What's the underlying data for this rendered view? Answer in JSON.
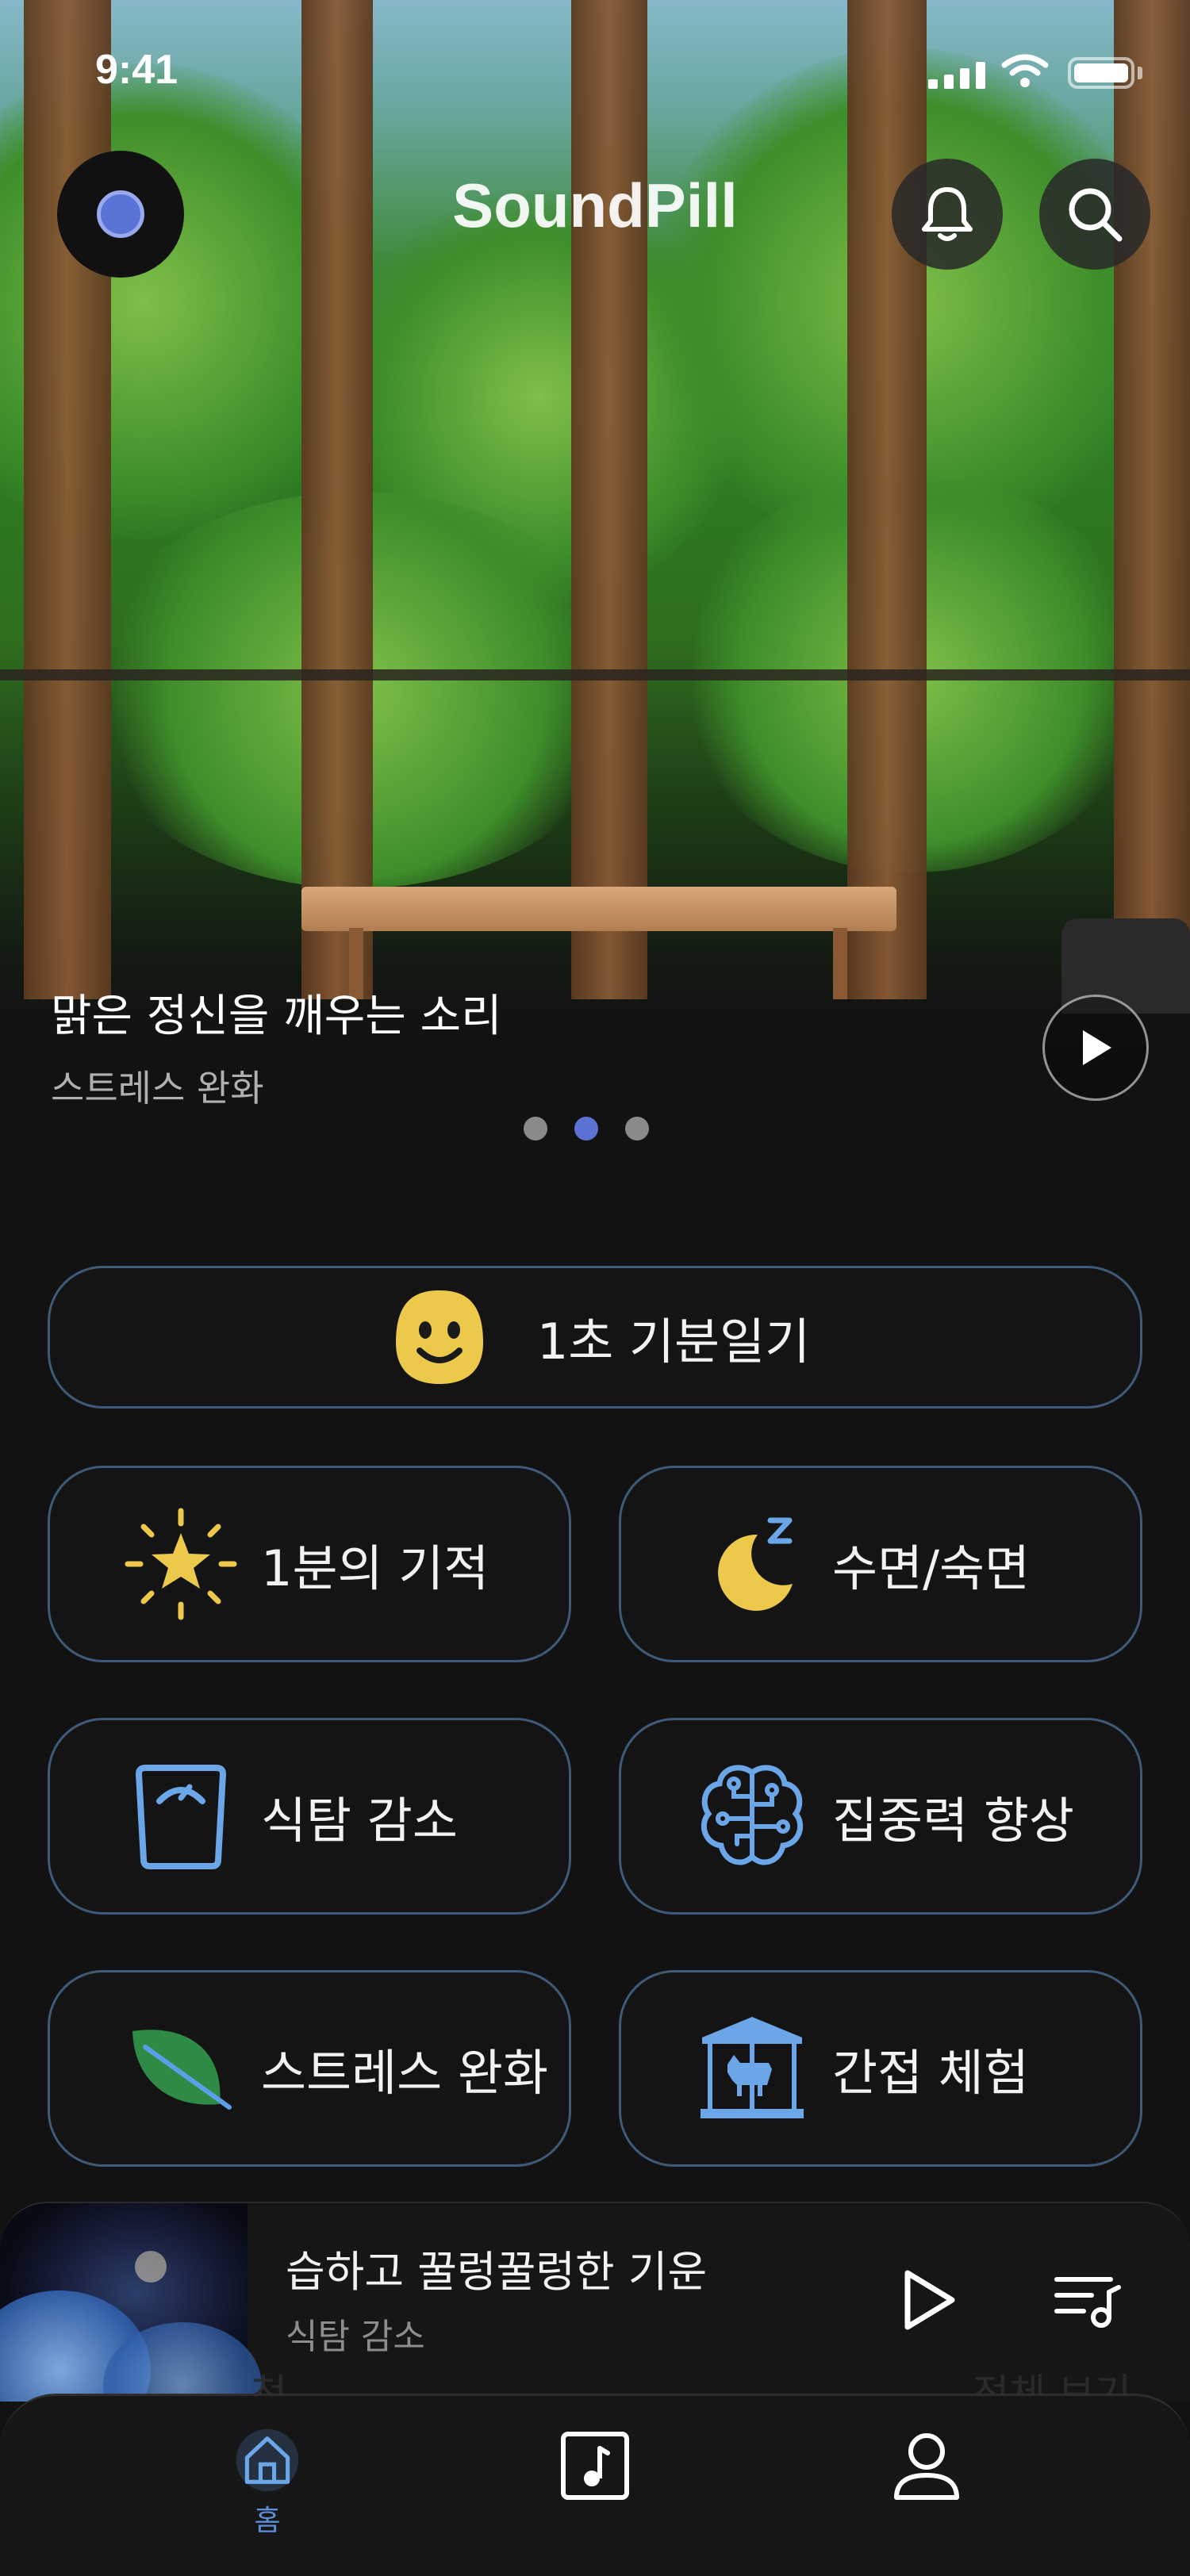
{
  "status_bar": {
    "time": "9:41"
  },
  "header": {
    "app_title": "SoundPill"
  },
  "hero": {
    "title": "맑은 정신을 깨우는 소리",
    "subtitle": "스트레스 완화",
    "pagination": {
      "count": 3,
      "active_index": 1
    }
  },
  "mood_button": {
    "label": "1초 기분일기",
    "icon": "smiley-icon"
  },
  "categories": [
    {
      "label": "1분의 기적",
      "icon": "sparkle-star-icon"
    },
    {
      "label": "수면/숙면",
      "icon": "moon-sleep-icon"
    },
    {
      "label": "식탐 감소",
      "icon": "scale-icon"
    },
    {
      "label": "집중력 향상",
      "icon": "brain-icon"
    },
    {
      "label": "스트레스 완화",
      "icon": "leaf-icon"
    },
    {
      "label": "간접 체험",
      "icon": "carousel-icon"
    }
  ],
  "mini_player": {
    "track_title": "습하고 꿀렁꿀렁한 기운",
    "track_category": "식탐 감소",
    "faded_left": "천",
    "faded_right": "전체 보기"
  },
  "tab_bar": {
    "tabs": [
      {
        "id": "home",
        "label": "홈",
        "icon": "home-icon",
        "active": true
      },
      {
        "id": "music",
        "label": "",
        "icon": "music-note-icon",
        "active": false
      },
      {
        "id": "profile",
        "label": "",
        "icon": "person-icon",
        "active": false
      }
    ]
  },
  "colors": {
    "background": "#121212",
    "card_border": "#3e5a78",
    "accent_blue": "#5c8fd8",
    "icon_yellow": "#ecc94b",
    "icon_blue": "#6aa6e8",
    "leaf_green": "#2e8a44"
  }
}
